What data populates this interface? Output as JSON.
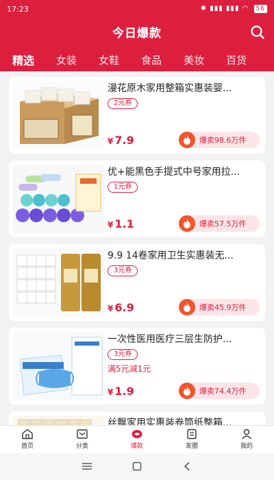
{
  "status": {
    "time": "17:23",
    "icons": "✱ ▮▮▮ ▮▮▮ ◠",
    "battery": "56"
  },
  "header": {
    "title": "今日爆款"
  },
  "tabs": [
    "精选",
    "女装",
    "女鞋",
    "食品",
    "美妆",
    "百货"
  ],
  "products": [
    {
      "title": "漫花原木家用整箱实惠装婴...",
      "coupon": "2元券",
      "promo": "",
      "price_symbol": "¥",
      "price": "7.9",
      "sold": "爆卖98.6万件"
    },
    {
      "title": "优+能黑色手提式中号家用拉...",
      "coupon": "1元券",
      "promo": "",
      "price_symbol": "¥",
      "price": "1.1",
      "sold": "爆卖57.5万件"
    },
    {
      "title": "9.9 14卷家用卫生实惠装无...",
      "coupon": "3元券",
      "promo": "",
      "price_symbol": "¥",
      "price": "6.9",
      "sold": "爆卖45.9万件"
    },
    {
      "title": "一次性医用医疗三层生防护...",
      "coupon": "3元券",
      "promo": "满5元减1元",
      "price_symbol": "¥",
      "price": "1.9",
      "sold": "爆卖74.4万件"
    },
    {
      "title": "丝飘家用实惠装卷筒纸整箱...",
      "coupon": "",
      "promo": "",
      "price_symbol": "",
      "price": "",
      "sold": ""
    }
  ],
  "bottom_nav": [
    "首页",
    "分类",
    "爆款",
    "发圈",
    "我的"
  ],
  "colors": {
    "brand": "#dc1f3f",
    "coupon_bg": "#fde4e7",
    "fire": "#f2542d"
  }
}
